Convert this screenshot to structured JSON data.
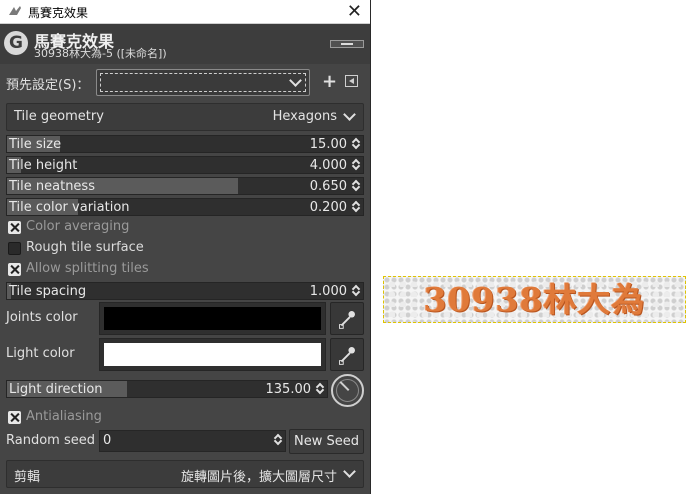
{
  "window": {
    "title": "馬賽克效果",
    "close_glyph": "✕"
  },
  "header": {
    "logo_letter": "G",
    "title": "馬賽克效果",
    "subtitle": "30938林大為-5 ([未命名])"
  },
  "presets": {
    "label": "預先設定(S)：",
    "value": ""
  },
  "tile_geometry": {
    "label": "Tile geometry",
    "value": "Hexagons"
  },
  "sliders": [
    {
      "label": "Tile size",
      "value": "15.00",
      "fill_fraction": 0.15
    },
    {
      "label": "Tile height",
      "value": "4.000",
      "fill_fraction": 0.04
    },
    {
      "label": "Tile neatness",
      "value": "0.650",
      "fill_fraction": 0.65
    },
    {
      "label": "Tile color variation",
      "value": "0.200",
      "fill_fraction": 0.2
    }
  ],
  "checkboxes": [
    {
      "label": "Color averaging",
      "checked": true,
      "dimmed": true
    },
    {
      "label": "Rough tile surface",
      "checked": false,
      "dimmed": false
    },
    {
      "label": "Allow splitting tiles",
      "checked": true,
      "dimmed": true
    }
  ],
  "tile_spacing": {
    "label": "Tile spacing",
    "value": "1.000",
    "fill_fraction": 0.01
  },
  "joints_color": {
    "label": "Joints color",
    "color": "#000000"
  },
  "light_color": {
    "label": "Light color",
    "color": "#ffffff"
  },
  "light_direction": {
    "label": "Light direction",
    "value": "135.00",
    "fill_fraction": 0.375
  },
  "antialiasing": {
    "label": "Antialiasing",
    "checked": true
  },
  "random_seed": {
    "label": "Random seed",
    "value": "0",
    "button": "New Seed"
  },
  "clipping": {
    "label": "剪輯",
    "value": "旋轉圖片後，擴大圖層尺寸"
  },
  "preview": {
    "text": "30938林大為"
  },
  "icons": {
    "app": "wilber-icon",
    "add_preset": "plus-icon",
    "preset_menu": "menu-triangle-icon",
    "picker": "eyedropper-icon",
    "dial": "direction-dial-icon"
  }
}
